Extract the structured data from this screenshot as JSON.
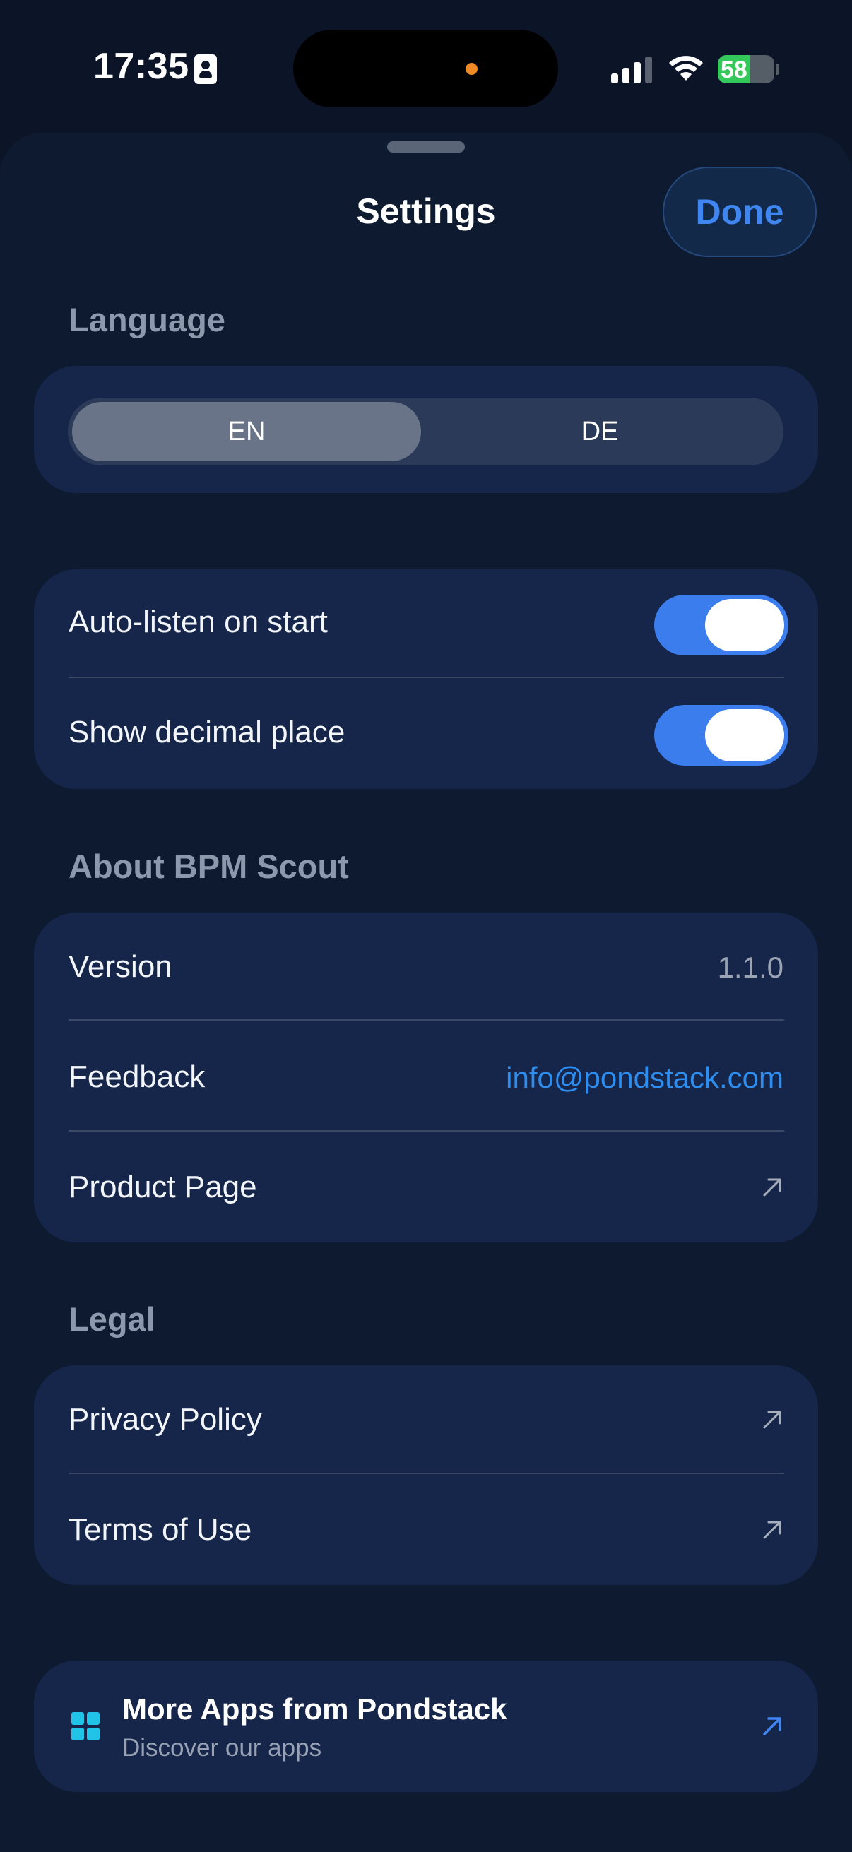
{
  "status_bar": {
    "time": "17:35",
    "battery": "58",
    "battery_level": 0.58
  },
  "header": {
    "title": "Settings",
    "done_label": "Done"
  },
  "language": {
    "header": "Language",
    "options": [
      "EN",
      "DE"
    ],
    "selected": "EN"
  },
  "toggles": [
    {
      "label": "Auto-listen on start",
      "on": true
    },
    {
      "label": "Show decimal place",
      "on": true
    }
  ],
  "about": {
    "header": "About BPM Scout",
    "version_label": "Version",
    "version_value": "1.1.0",
    "feedback_label": "Feedback",
    "feedback_value": "info@pondstack.com",
    "product_page_label": "Product Page"
  },
  "legal": {
    "header": "Legal",
    "privacy_label": "Privacy Policy",
    "terms_label": "Terms of Use"
  },
  "more_apps": {
    "title": "More Apps from Pondstack",
    "subtitle": "Discover our apps"
  },
  "colors": {
    "accent": "#3b7ded",
    "link": "#2e8ef0",
    "background": "#0c1527",
    "card": "#16264a",
    "apps_icon": "#21c3e6"
  }
}
